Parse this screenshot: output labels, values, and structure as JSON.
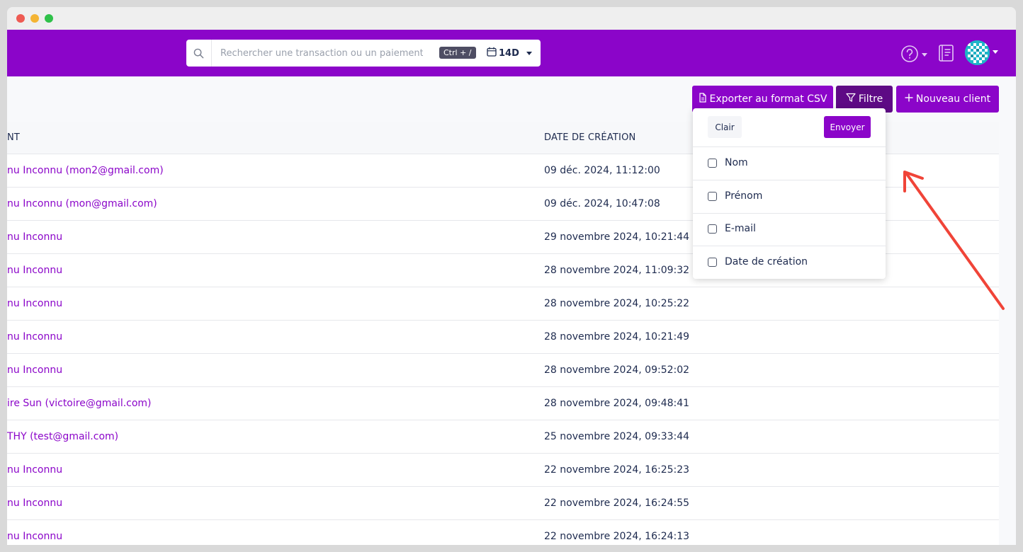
{
  "window": {
    "controls": [
      "close",
      "minimize",
      "maximize"
    ]
  },
  "header": {
    "search": {
      "placeholder": "Rechercher une transaction ou un paiement",
      "value": "",
      "shortcut": "Ctrl + /"
    },
    "period": {
      "label": "14D"
    },
    "icons": [
      "search-icon",
      "calendar-icon",
      "help-icon",
      "book-icon",
      "avatar"
    ]
  },
  "toolbar": {
    "export_label": "Exporter au format CSV",
    "filter_label": "Filtre",
    "new_client_label": "Nouveau client"
  },
  "table": {
    "columns": [
      "NT",
      "DATE DE CRÉATION"
    ],
    "rows": [
      {
        "client": "nu Inconnu (mon2@gmail.com)",
        "date": "09 déc. 2024, 11:12:00"
      },
      {
        "client": "nu Inconnu (mon@gmail.com)",
        "date": "09 déc. 2024, 10:47:08"
      },
      {
        "client": "nu Inconnu",
        "date": "29 novembre 2024, 10:21:44"
      },
      {
        "client": "nu Inconnu",
        "date": "28 novembre 2024, 11:09:32"
      },
      {
        "client": "nu Inconnu",
        "date": "28 novembre 2024, 10:25:22"
      },
      {
        "client": "nu Inconnu",
        "date": "28 novembre 2024, 10:21:49"
      },
      {
        "client": "nu Inconnu",
        "date": "28 novembre 2024, 09:52:02"
      },
      {
        "client": "ire Sun (victoire@gmail.com)",
        "date": "28 novembre 2024, 09:48:41"
      },
      {
        "client": " THY (test@gmail.com)",
        "date": "25 novembre 2024, 09:33:44"
      },
      {
        "client": "nu Inconnu",
        "date": "22 novembre 2024, 16:25:23"
      },
      {
        "client": "nu Inconnu",
        "date": "22 novembre 2024, 16:24:55"
      },
      {
        "client": "nu Inconnu",
        "date": "22 novembre 2024, 16:24:13"
      }
    ]
  },
  "filter_dropdown": {
    "clear_label": "Clair",
    "send_label": "Envoyer",
    "options": [
      {
        "label": "Nom",
        "checked": false
      },
      {
        "label": "Prénom",
        "checked": false
      },
      {
        "label": "E-mail",
        "checked": false
      },
      {
        "label": "Date de création",
        "checked": false
      }
    ]
  },
  "colors": {
    "brand": "#8b05c9",
    "brand_dark": "#5e0a85",
    "text_dark": "#1d2a4e",
    "annotation_arrow": "#f04438"
  }
}
